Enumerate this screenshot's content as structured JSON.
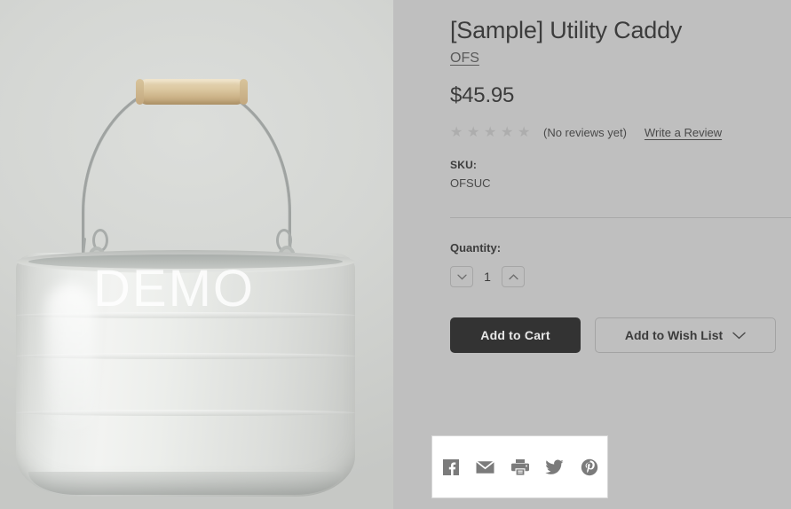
{
  "product": {
    "title": "[Sample] Utility Caddy",
    "brand": "OFS",
    "price": "$45.95",
    "reviews_text": "(No reviews yet)",
    "write_review_label": "Write a Review",
    "rating_stars": 5,
    "rating_value": 0,
    "sku_label": "SKU:",
    "sku_value": "OFSUC",
    "image_watermark": "DEMO",
    "image_alt": "product-photo-utility-caddy"
  },
  "quantity": {
    "label": "Quantity:",
    "value": "1",
    "decrease_icon": "chevron-down-icon",
    "increase_icon": "chevron-up-icon"
  },
  "actions": {
    "add_to_cart_label": "Add to Cart",
    "wish_list_label": "Add to Wish List",
    "wish_list_caret_icon": "chevron-down-icon"
  },
  "share": {
    "items": [
      {
        "name": "facebook-icon",
        "label": "Facebook"
      },
      {
        "name": "email-icon",
        "label": "Email"
      },
      {
        "name": "print-icon",
        "label": "Print"
      },
      {
        "name": "twitter-icon",
        "label": "Twitter"
      },
      {
        "name": "pinterest-icon",
        "label": "Pinterest"
      }
    ]
  },
  "colors": {
    "page_background": "#bfbfbf",
    "text_primary": "#3c3c3c",
    "text_secondary": "#4a4a4a",
    "button_dark": "#333333",
    "star_empty": "#adadad",
    "share_icon": "#7b7b7b",
    "divider": "#a9a9a9"
  }
}
